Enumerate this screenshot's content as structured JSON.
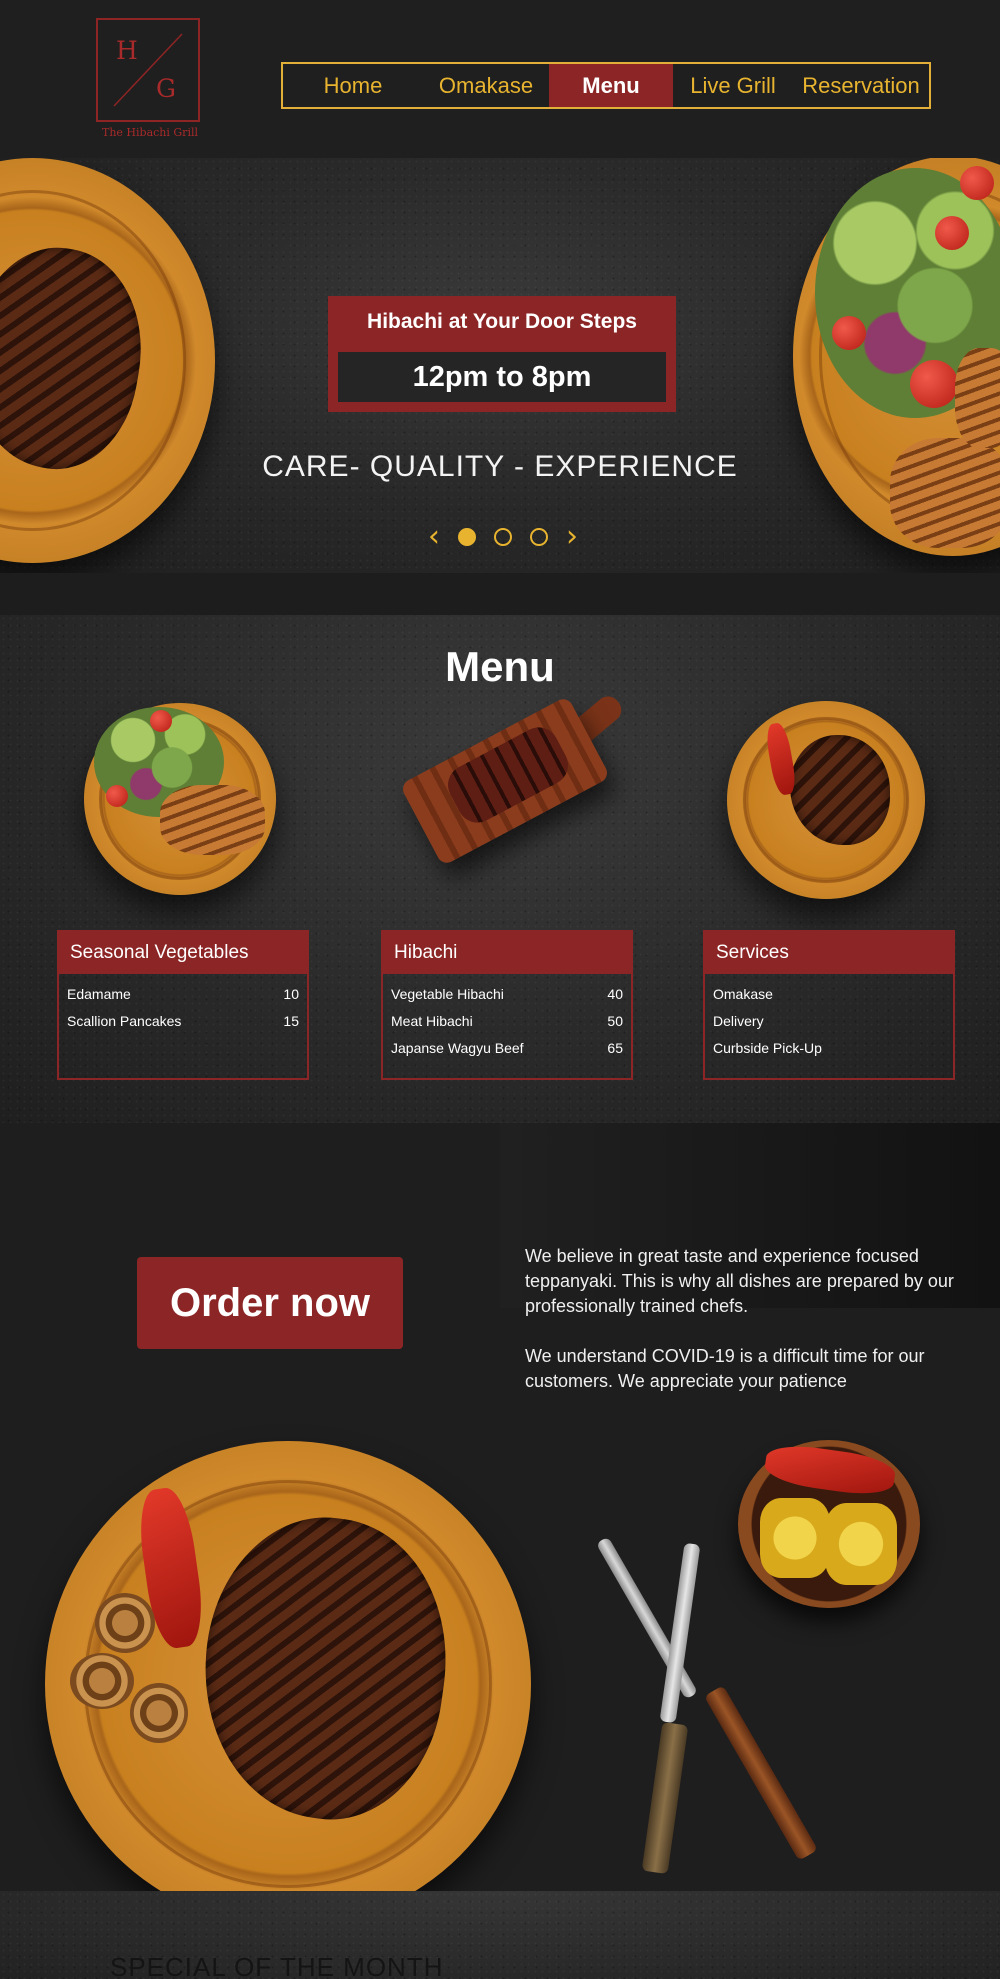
{
  "brand": {
    "monogram_top": "H",
    "monogram_bottom": "G",
    "name": "The Hibachi Grill"
  },
  "nav": {
    "items": [
      {
        "label": "Home"
      },
      {
        "label": "Omakase"
      },
      {
        "label": "Menu",
        "active": true
      },
      {
        "label": "Live Grill"
      },
      {
        "label": "Reservation"
      }
    ]
  },
  "hero": {
    "promo_title": "Hibachi at Your Door Steps",
    "hours": "12pm to 8pm",
    "tagline": "CARE- QUALITY - EXPERIENCE",
    "carousel": {
      "prev_icon": "‹",
      "next_icon": "›",
      "slides": 3,
      "active_slide": 1
    }
  },
  "menu": {
    "title": "Menu",
    "cards": [
      {
        "title": "Seasonal Vegetables",
        "items": [
          {
            "name": "Edamame",
            "price": "10"
          },
          {
            "name": "Scallion Pancakes",
            "price": "15"
          }
        ]
      },
      {
        "title": "Hibachi",
        "items": [
          {
            "name": "Vegetable Hibachi",
            "price": "40"
          },
          {
            "name": "Meat Hibachi",
            "price": "50"
          },
          {
            "name": "Japanse Wagyu Beef",
            "price": "65"
          }
        ]
      },
      {
        "title": "Services",
        "items": [
          {
            "name": "Omakase",
            "price": ""
          },
          {
            "name": "Delivery",
            "price": ""
          },
          {
            "name": "Curbside Pick-Up",
            "price": ""
          }
        ]
      }
    ]
  },
  "order": {
    "button_label": "Order now",
    "paragraph_1": "We believe in great taste and experience focused teppanyaki. This is why all dishes are prepared by our professionally trained chefs.",
    "paragraph_2": "We understand COVID-19 is a difficult time for our customers. We appreciate your patience"
  },
  "special": {
    "title": "SPECIAL OF THE MONTH"
  },
  "colors": {
    "brand_red": "#8c2525",
    "accent_gold": "#e8b430",
    "background": "#1d1d1d"
  }
}
